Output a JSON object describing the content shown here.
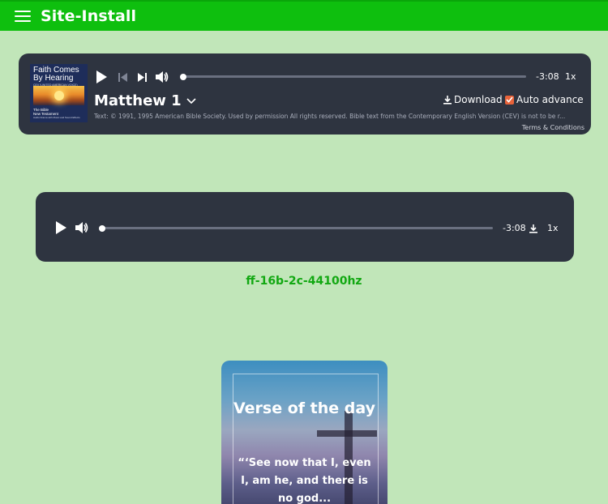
{
  "header": {
    "title": "Site-Install"
  },
  "bible_player": {
    "cover": {
      "title_line1": "Faith Comes",
      "title_line2": "By Hearing",
      "subtitle": "CEV (UNITED AMERICAN VOICE)",
      "bottom_line1": "The Bible",
      "bottom_line2": "New Testament",
      "bottom_line3": "Audio Drama with Music and Sound Effects"
    },
    "time_remaining": "-3:08",
    "speed": "1x",
    "chapter": "Matthew 1",
    "download_label": "Download",
    "auto_advance_label": "Auto advance",
    "auto_advance_checked": true,
    "progress": 0,
    "copyright": "Text: © 1991, 1995 American Bible Society. Used by permission All rights reserved. Bible text from the Contemporary English Version (CEV) is not to be r...",
    "terms_label": "Terms & Conditions"
  },
  "audio_player": {
    "time_remaining": "-3:08",
    "speed": "1x",
    "progress": 0
  },
  "file_label": "ff-16b-2c-44100hz",
  "verse_card": {
    "title": "Verse of the day",
    "text": "“‘See now that I, even I, am he, and there is no god..."
  },
  "colors": {
    "page_bg": "#c1e6b9",
    "header_bg": "#0ebf0e",
    "player_bg": "#2e3440",
    "accent_green": "#12a812",
    "checkbox": "#e8633a"
  }
}
